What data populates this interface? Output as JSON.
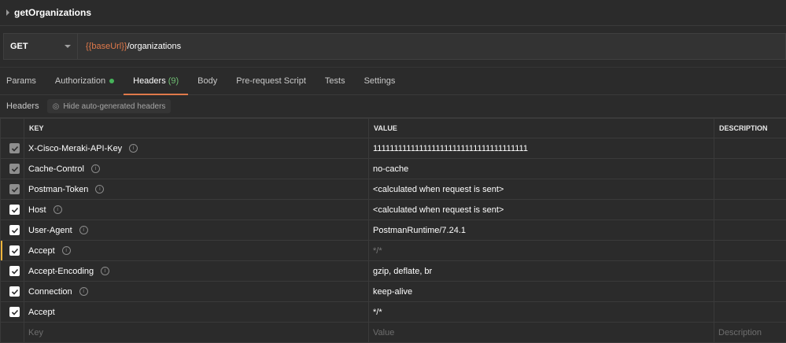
{
  "request": {
    "name": "getOrganizations"
  },
  "url_bar": {
    "method": "GET",
    "url_variable": "{{baseUrl}}",
    "url_path": "/organizations"
  },
  "tabs": {
    "params": "Params",
    "authorization": "Authorization",
    "headers": "Headers",
    "headers_count": "(9)",
    "body": "Body",
    "pre_request": "Pre-request Script",
    "tests": "Tests",
    "settings": "Settings"
  },
  "headers_bar": {
    "label": "Headers",
    "hide_button": "Hide auto-generated headers"
  },
  "table": {
    "col_key": "KEY",
    "col_value": "VALUE",
    "col_description": "DESCRIPTION",
    "rows": [
      {
        "key": "X-Cisco-Meraki-API-Key",
        "value": "1111111111111111111111111111111111111"
      },
      {
        "key": "Cache-Control",
        "value": "no-cache"
      },
      {
        "key": "Postman-Token",
        "value": "<calculated when request is sent>"
      },
      {
        "key": "Host",
        "value": "<calculated when request is sent>"
      },
      {
        "key": "User-Agent",
        "value": "PostmanRuntime/7.24.1"
      },
      {
        "key": "Accept",
        "value": "*/*"
      },
      {
        "key": "Accept-Encoding",
        "value": "gzip, deflate, br"
      },
      {
        "key": "Connection",
        "value": "keep-alive"
      },
      {
        "key": "Accept",
        "value": "*/*"
      }
    ],
    "new_row": {
      "key_placeholder": "Key",
      "value_placeholder": "Value",
      "description_placeholder": "Description"
    }
  },
  "colors": {
    "accent": "#e0794a",
    "active_tab_underline": "#e0794a",
    "auth_dot": "#46b35a",
    "row_highlight": "#f0b43c"
  }
}
